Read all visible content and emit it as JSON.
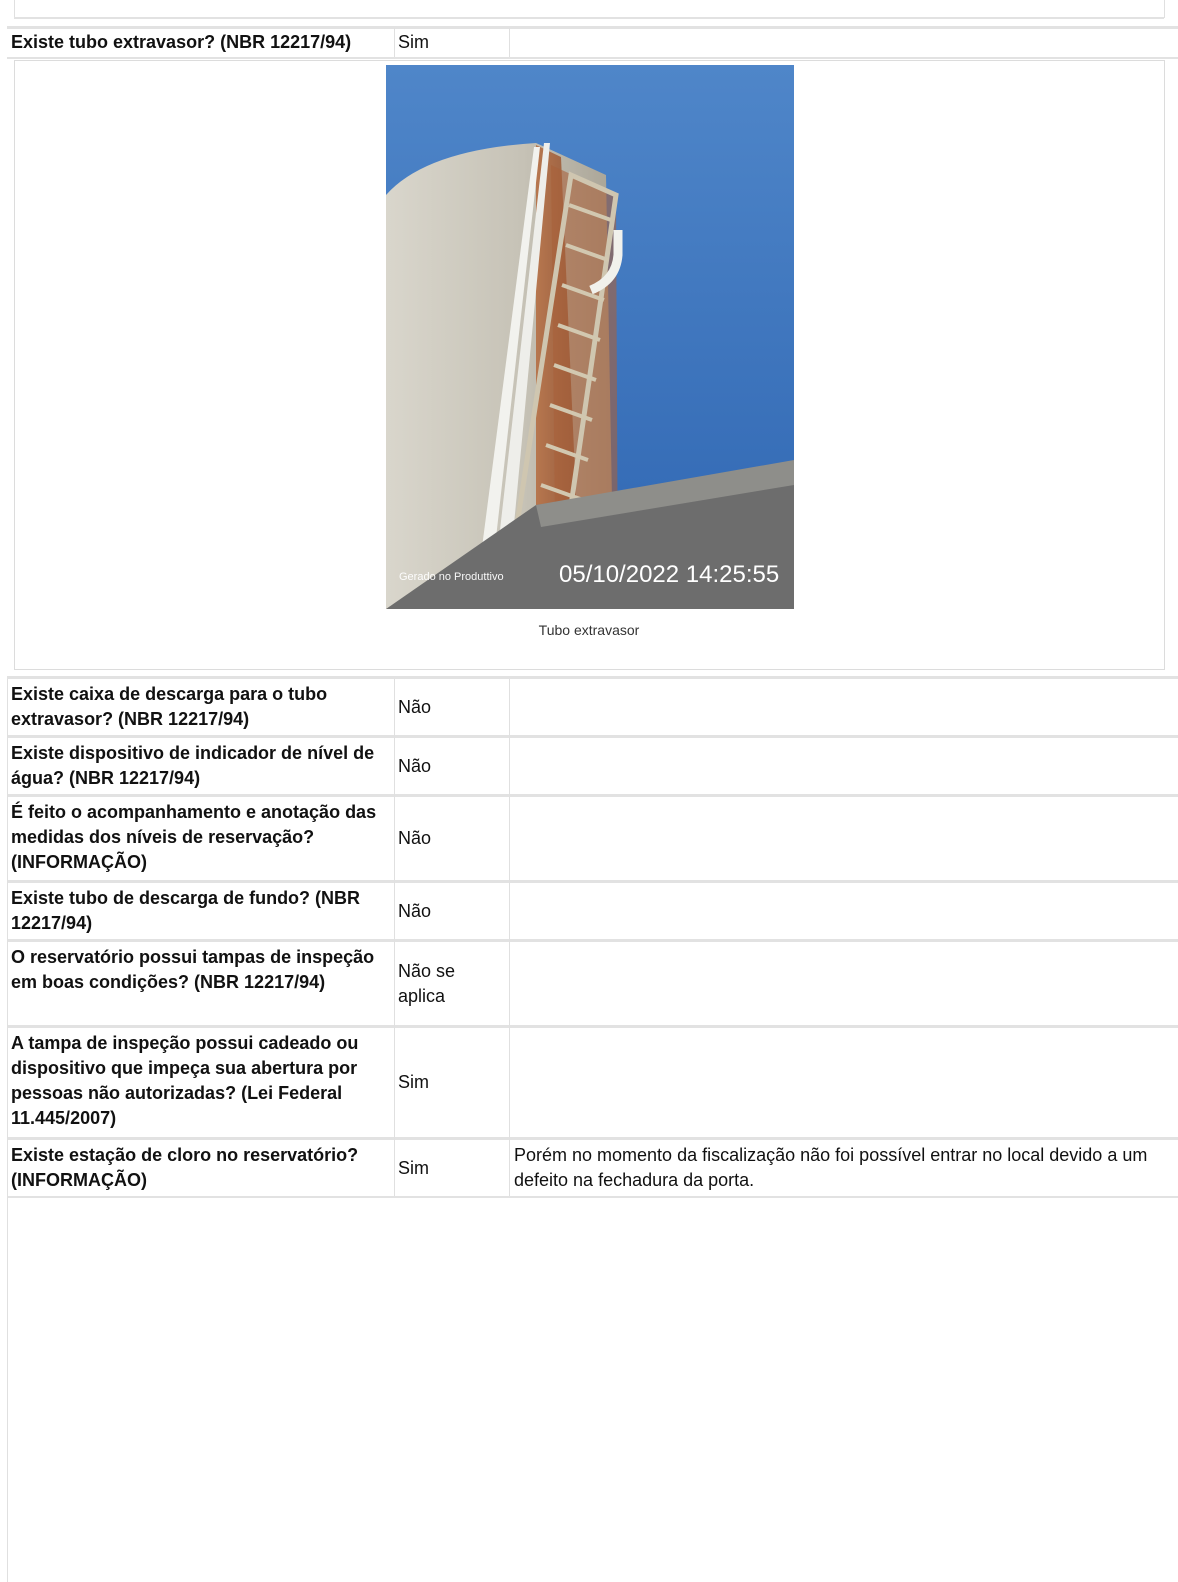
{
  "rows": [
    {
      "question": "Existe tubo extravasor? (NBR 12217/94)",
      "answer": "Sim",
      "note": ""
    },
    {
      "question": "Existe caixa de descarga para o tubo extravasor? (NBR 12217/94)",
      "answer": "Não",
      "note": ""
    },
    {
      "question": "Existe dispositivo de indicador de nível de água? (NBR 12217/94)",
      "answer": "Não",
      "note": ""
    },
    {
      "question": "É feito o acompanhamento e anotação das medidas dos níveis de reservação? (INFORMAÇÃO)",
      "answer": "Não",
      "note": ""
    },
    {
      "question": "Existe tubo de descarga de fundo? (NBR 12217/94)",
      "answer": "Não",
      "note": ""
    },
    {
      "question": "O reservatório possui tampas de inspeção em boas condições? (NBR 12217/94)",
      "answer": "Não se aplica",
      "note": ""
    },
    {
      "question": "A tampa de inspeção possui cadeado ou dispositivo que impeça sua abertura por pessoas não autorizadas? (Lei Federal 11.445/2007)",
      "answer": "Sim",
      "note": ""
    },
    {
      "question": "Existe estação de cloro no reservatório? (INFORMAÇÃO)",
      "answer": "Sim",
      "note": "Porém no momento da fiscalização não foi possível entrar no local devido a um defeito na fechadura da porta."
    }
  ],
  "photo": {
    "caption": "Tubo extravasor",
    "watermark_app": "Gerado no Produttivo",
    "watermark_timestamp": "05/10/2022 14:25:55"
  }
}
